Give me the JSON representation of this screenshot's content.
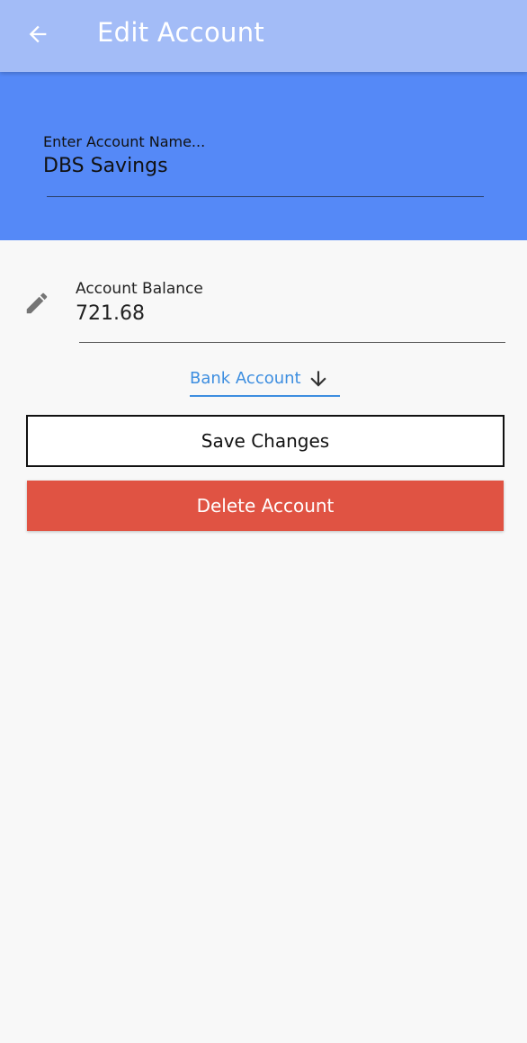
{
  "app_bar": {
    "back_icon": "arrow-left-icon",
    "title": "Edit Account"
  },
  "account_name": {
    "label": "Enter Account Name...",
    "value": "DBS Savings"
  },
  "account_balance": {
    "icon": "pencil-icon",
    "label": "Account Balance",
    "value": "721.68"
  },
  "account_type": {
    "selected": "Bank Account",
    "icon": "arrow-down-icon"
  },
  "actions": {
    "save_label": "Save Changes",
    "delete_label": "Delete Account"
  },
  "colors": {
    "app_bar": "#a3bcf7",
    "header_panel": "#5589f7",
    "accent": "#3d8ee0",
    "danger": "#e05343",
    "background": "#f8f8f8"
  }
}
